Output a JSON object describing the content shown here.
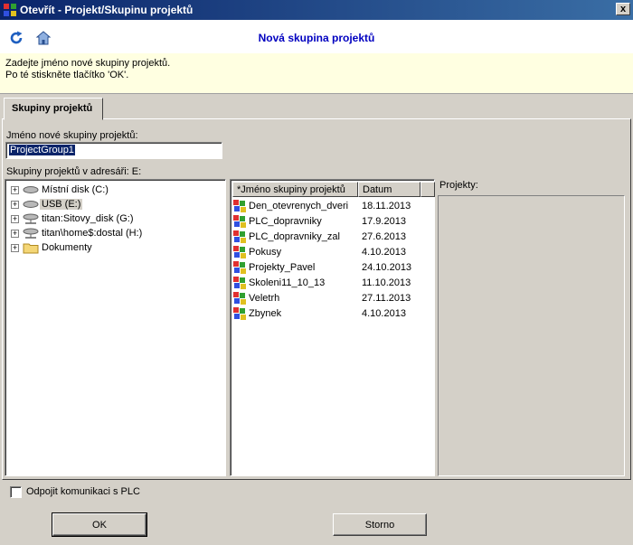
{
  "window": {
    "title": "Otevřít - Projekt/Skupinu projektů",
    "close_label": "x"
  },
  "header": {
    "title": "Nová skupina projektů",
    "icons": [
      "refresh-icon",
      "home-icon"
    ]
  },
  "info": {
    "line1": "Zadejte jméno nové skupiny projektů.",
    "line2": "Po té stiskněte tlačítko 'OK'."
  },
  "tab": {
    "label": "Skupiny projektů"
  },
  "name_field": {
    "label": "Jméno nové skupiny projektů:",
    "value": "ProjectGroup1"
  },
  "dir_label": "Skupiny projektů v adresáři:  E:",
  "tree": {
    "items": [
      {
        "label": "Místní disk (C:)",
        "icon": "hard-drive-icon"
      },
      {
        "label": "USB (E:)",
        "icon": "usb-drive-icon",
        "selected": true
      },
      {
        "label": "titan:Sitovy_disk (G:)",
        "icon": "network-drive-icon"
      },
      {
        "label": "titan\\home$:dostal (H:)",
        "icon": "network-drive-icon"
      },
      {
        "label": "Dokumenty",
        "icon": "folder-icon"
      }
    ]
  },
  "list": {
    "columns": {
      "name": "Jméno skupiny projektů",
      "date": "Datum"
    },
    "rows": [
      {
        "name": "Den_otevrenych_dveri",
        "date": "18.11.2013"
      },
      {
        "name": "PLC_dopravniky",
        "date": "17.9.2013"
      },
      {
        "name": "PLC_dopravniky_zal",
        "date": "27.6.2013"
      },
      {
        "name": "Pokusy",
        "date": "4.10.2013"
      },
      {
        "name": "Projekty_Pavel",
        "date": "24.10.2013"
      },
      {
        "name": "Skoleni11_10_13",
        "date": "11.10.2013"
      },
      {
        "name": "Veletrh",
        "date": "27.11.2013"
      },
      {
        "name": "Zbynek",
        "date": "4.10.2013"
      }
    ]
  },
  "projects_label": "Projekty:",
  "checkbox": {
    "label": "Odpojit komunikaci s PLC",
    "checked": false
  },
  "buttons": {
    "ok": "OK",
    "cancel": "Storno"
  },
  "colors": {
    "title_bar": "#0a246a",
    "header_title": "#0000c0",
    "info_bg": "#ffffe1"
  }
}
